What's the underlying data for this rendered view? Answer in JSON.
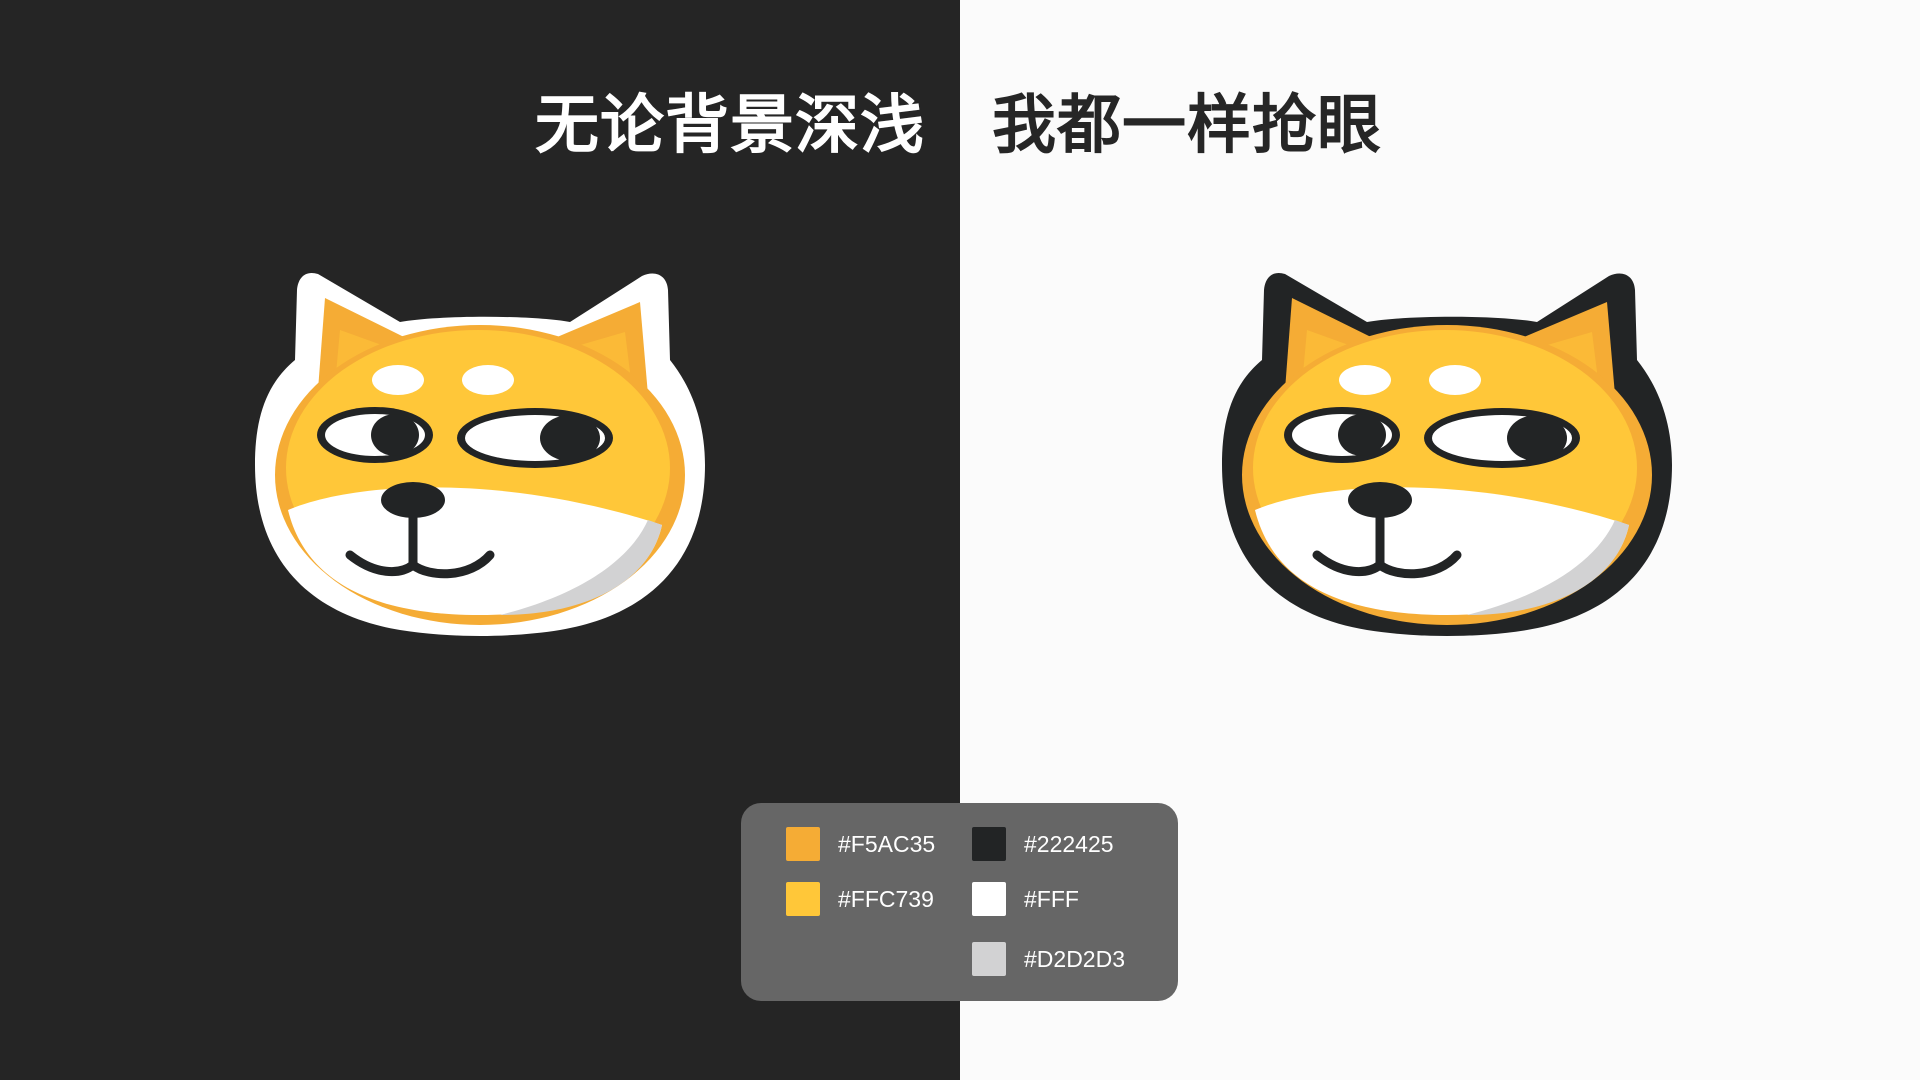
{
  "headline": {
    "left": "无论背景深浅",
    "right": "我都一样抢眼"
  },
  "colors": {
    "dark_background": "#252525",
    "light_background": "#FBFBFB",
    "outline_dark_variant": "#FFFFFF",
    "outline_light_variant": "#222425",
    "ear_and_rim": "#F5AC35",
    "face": "#FFC739",
    "muzzle": "#FFFFFF",
    "shadow": "#D2D2D3",
    "features": "#222425",
    "palette_background": "#666666"
  },
  "mascot": {
    "name_icon": "shiba-dog-face-icon"
  },
  "palette": {
    "swatches": [
      {
        "label": "#F5AC35",
        "color": "#F5AC35"
      },
      {
        "label": "#222425",
        "color": "#222425"
      },
      {
        "label": "#FFC739",
        "color": "#FFC739"
      },
      {
        "label": "#FFF",
        "color": "#FFFFFF"
      },
      {
        "label": "#D2D2D3",
        "color": "#D2D2D3"
      }
    ]
  }
}
